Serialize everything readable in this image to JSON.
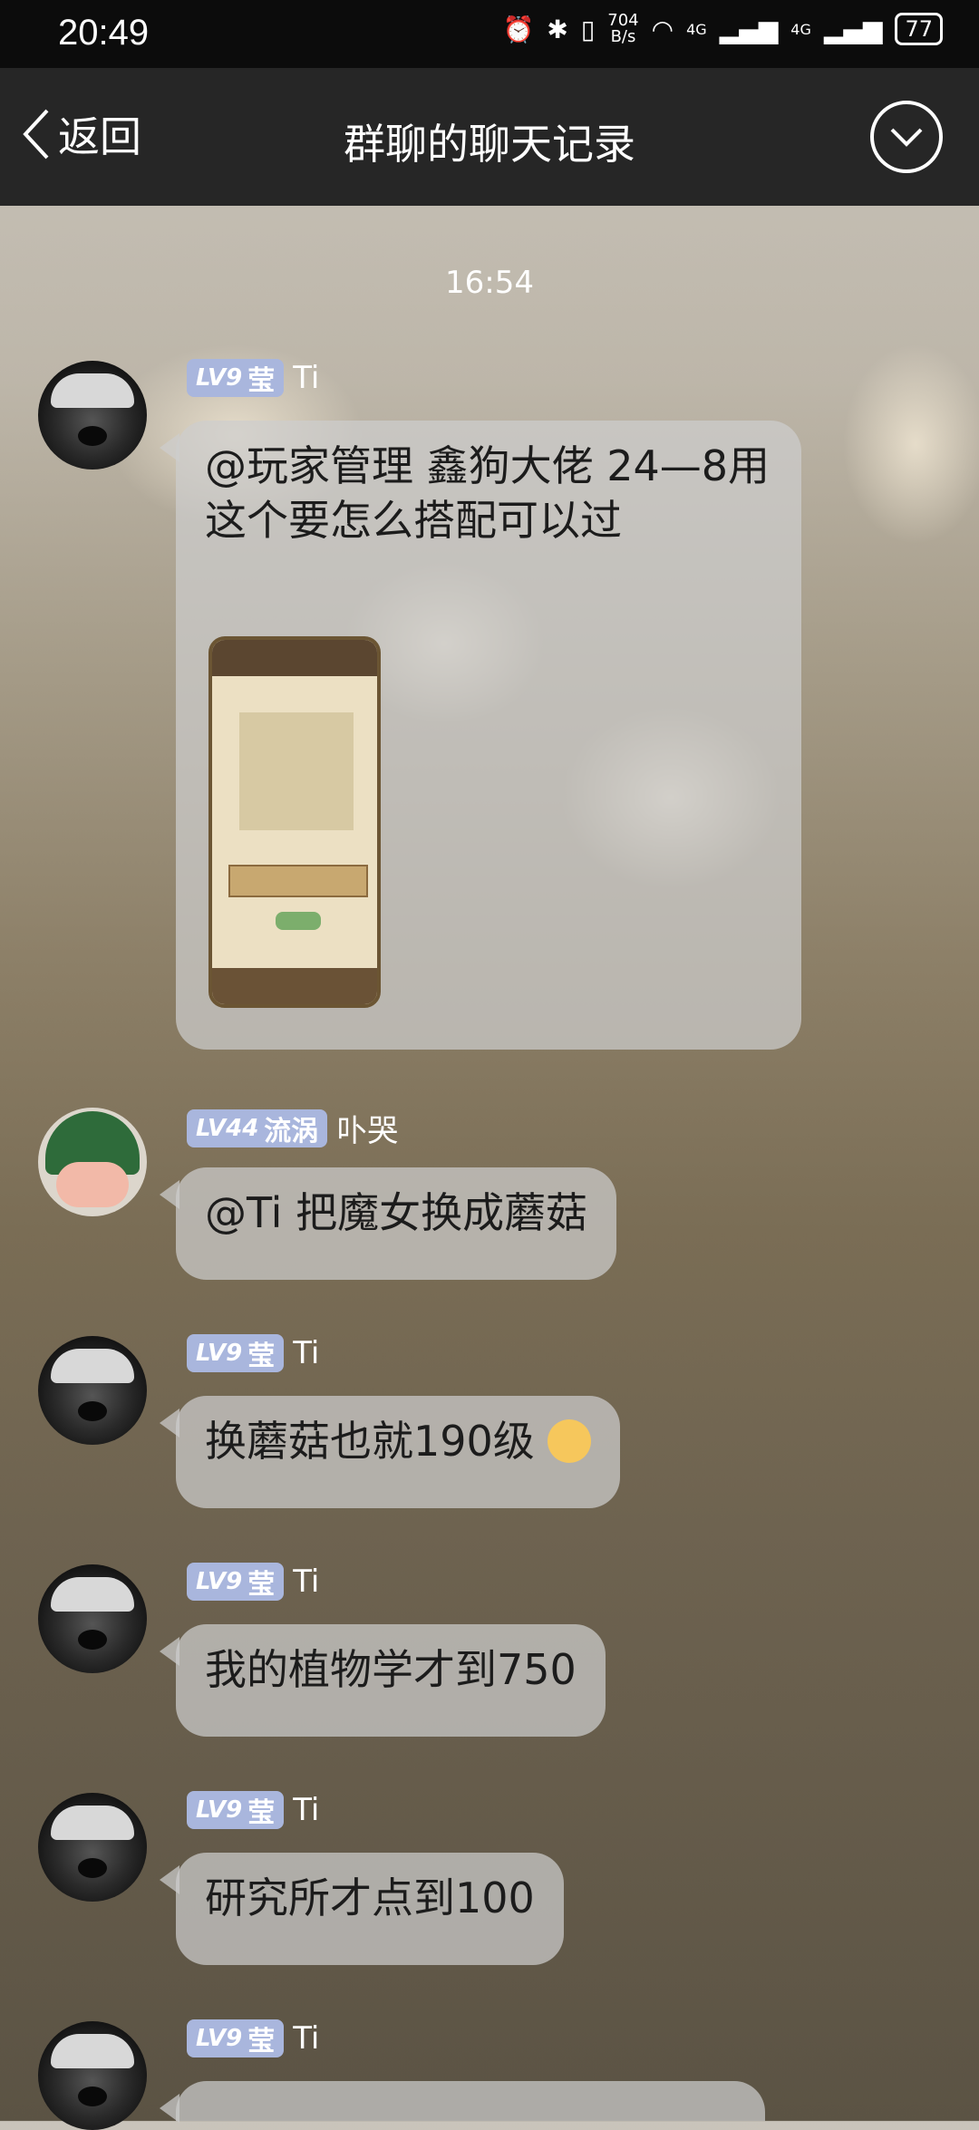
{
  "status_bar": {
    "time": "20:49",
    "network_speed": "704\nB/s",
    "signal_1": "4G",
    "signal_2": "4G",
    "battery": "77"
  },
  "nav": {
    "back_label": "返回",
    "title": "群聊的聊天记录"
  },
  "timestamp": "16:54",
  "messages": [
    {
      "level": "LV9",
      "title": "莹",
      "sender": "Ti",
      "text": "@玩家管理   鑫狗大佬 24—8用这个要怎么搭配可以过",
      "has_image": true
    },
    {
      "level": "LV44",
      "title": "流涡",
      "sender": "卟哭",
      "text": "@Ti 把魔女换成蘑菇"
    },
    {
      "level": "LV9",
      "title": "莹",
      "sender": "Ti",
      "text": "换蘑菇也就190级",
      "emoji": "smirk-emoji"
    },
    {
      "level": "LV9",
      "title": "莹",
      "sender": "Ti",
      "text": "我的植物学才到750"
    },
    {
      "level": "LV9",
      "title": "莹",
      "sender": "Ti",
      "text": "研究所才点到100"
    },
    {
      "level": "LV9",
      "title": "莹",
      "sender": "Ti",
      "text": ""
    }
  ],
  "colors": {
    "status_bar_bg": "#0c0c0c",
    "nav_bg": "#262626",
    "badge_bg": "#a9b6dd",
    "bubble_bg": "#cdcdcd"
  }
}
